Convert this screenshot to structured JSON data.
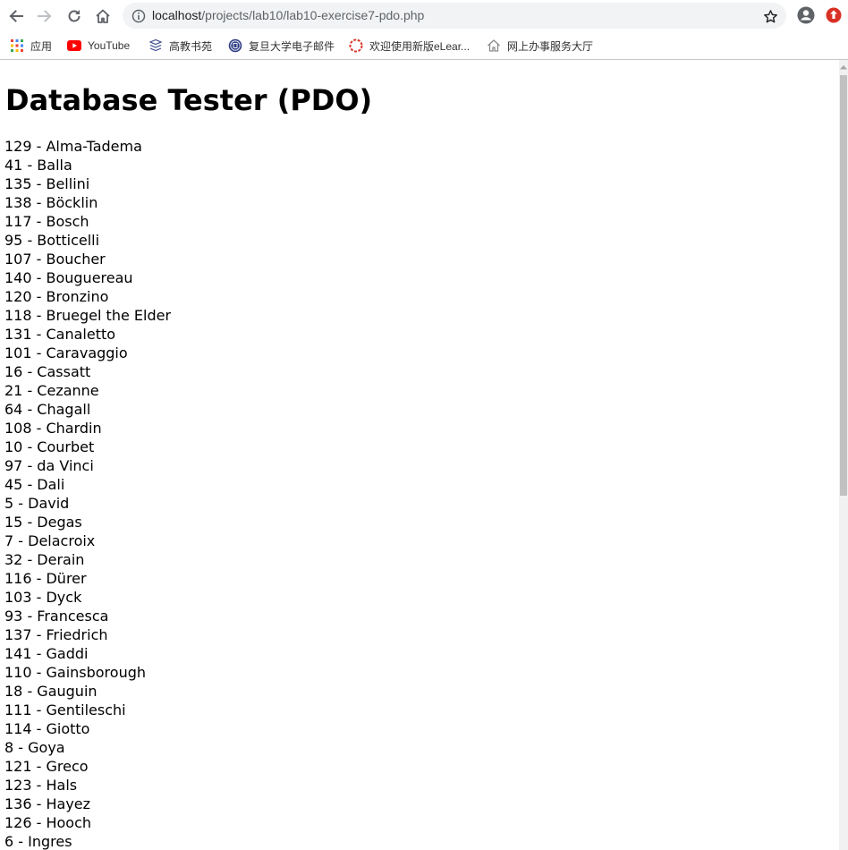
{
  "browser": {
    "url_host": "localhost",
    "url_path": "/projects/lab10/lab10-exercise7-pdo.php",
    "bookmarks": [
      {
        "label": "应用",
        "icon": "apps-grid-icon"
      },
      {
        "label": "YouTube",
        "icon": "youtube-icon"
      },
      {
        "label": "高教书苑",
        "icon": "book-stack-icon"
      },
      {
        "label": "复旦大学电子邮件",
        "icon": "fudan-seal-icon"
      },
      {
        "label": "欢迎使用新版eLear...",
        "icon": "elearning-ring-icon"
      },
      {
        "label": "网上办事服务大厅",
        "icon": "house-icon"
      }
    ]
  },
  "page": {
    "title": "Database Tester (PDO)",
    "artists": [
      "129 - Alma-Tadema",
      "41 - Balla",
      "135 - Bellini",
      "138 - Böcklin",
      "117 - Bosch",
      "95 - Botticelli",
      "107 - Boucher",
      "140 - Bouguereau",
      "120 - Bronzino",
      "118 - Bruegel the Elder",
      "131 - Canaletto",
      "101 - Caravaggio",
      "16 - Cassatt",
      "21 - Cezanne",
      "64 - Chagall",
      "108 - Chardin",
      "10 - Courbet",
      "97 - da Vinci",
      "45 - Dali",
      "5 - David",
      "15 - Degas",
      "7 - Delacroix",
      "32 - Derain",
      "116 - Dürer",
      "103 - Dyck",
      "93 - Francesca",
      "137 - Friedrich",
      "141 - Gaddi",
      "110 - Gainsborough",
      "18 - Gauguin",
      "111 - Gentileschi",
      "114 - Giotto",
      "8 - Goya",
      "121 - Greco",
      "123 - Hals",
      "136 - Hayez",
      "126 - Hooch",
      "6 - Ingres"
    ]
  },
  "colors": {
    "omnibox_bg": "#f1f3f4",
    "icon_gray": "#5f6368",
    "update_red": "#d93025",
    "youtube_red": "#ff0000",
    "scroll_thumb": "#c1c1c1"
  }
}
